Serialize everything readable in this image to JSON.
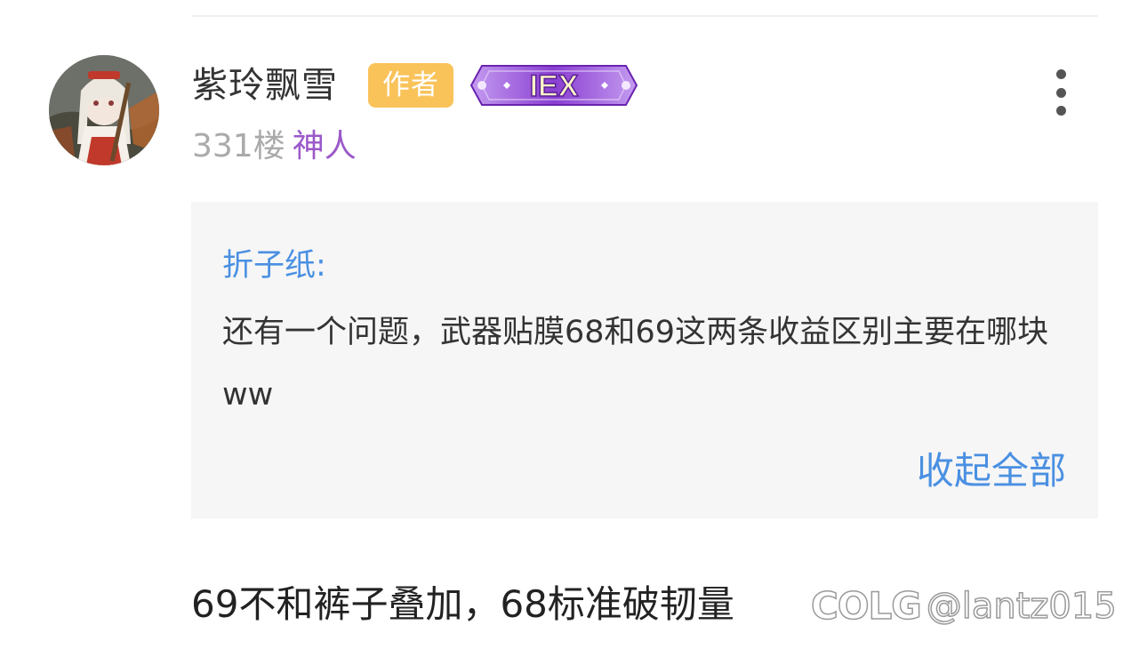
{
  "post": {
    "username": "紫玲飘雪",
    "author_badge": "作者",
    "level_badge": "IEX",
    "floor": "331楼",
    "user_title": "神人"
  },
  "quote": {
    "author": "折子纸:",
    "text": "还有一个问题，武器贴膜68和69这两条收益区别主要在哪块ww",
    "collapse_label": "收起全部"
  },
  "reply": {
    "text": "69不和裤子叠加，68标准破韧量"
  },
  "watermark": {
    "logo": "COLG",
    "handle": "@lantz015"
  },
  "icons": {
    "more": "more-vertical-icon",
    "level_badge": "level-badge-icon"
  },
  "colors": {
    "author_badge": "#f9c35a",
    "user_title": "#9b59c9",
    "link": "#4a90e2",
    "quote_bg": "#f6f6f6",
    "level_badge": "#8a3fd1"
  }
}
